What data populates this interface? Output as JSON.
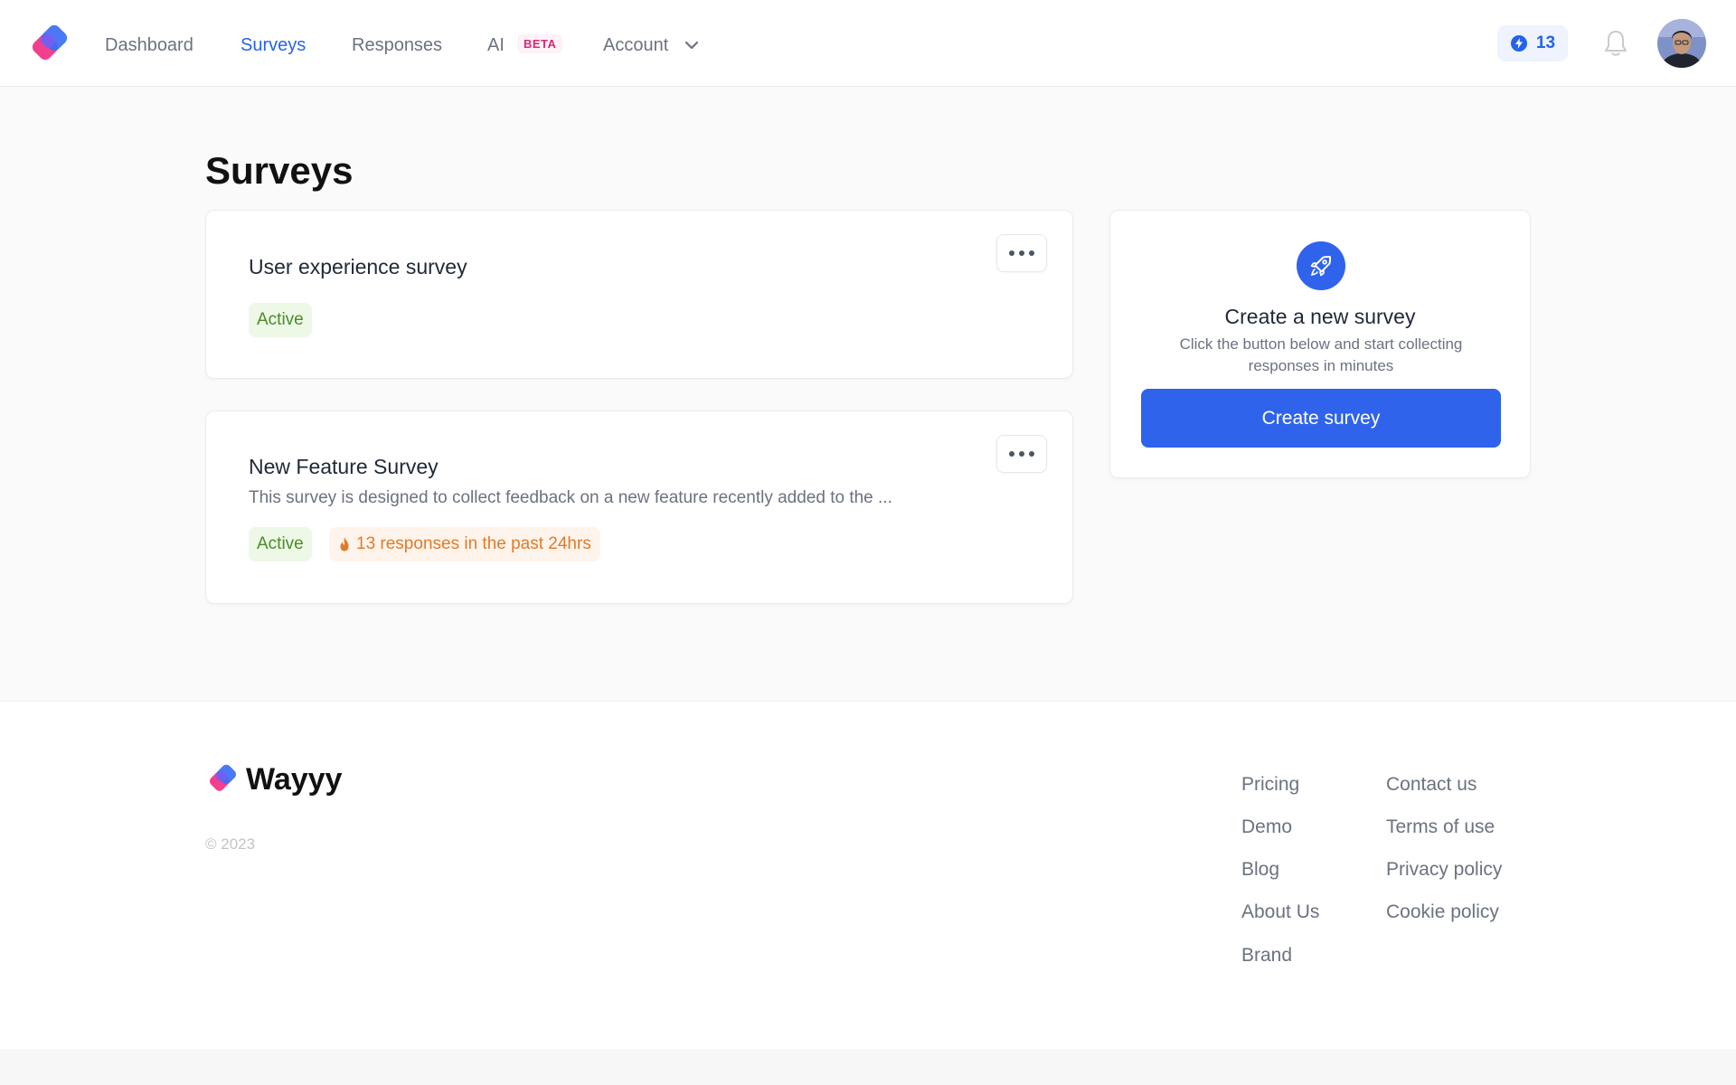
{
  "nav": {
    "links": [
      "Dashboard",
      "Surveys",
      "Responses",
      "AI",
      "Account"
    ],
    "active": "Surveys",
    "beta_label": "BETA",
    "credits": "13",
    "icons": {
      "logo": "wayyy-logo-icon",
      "credits": "bolt-circle-icon",
      "bell": "bell-icon",
      "account_dropdown": "chevron-down-icon"
    }
  },
  "main": {
    "title": "Surveys",
    "surveys": [
      {
        "title": "User experience survey",
        "description": "",
        "status": "Active",
        "activity": ""
      },
      {
        "title": "New Feature Survey",
        "description": "This survey is designed to collect feedback on a new feature recently added to the ...",
        "status": "Active",
        "activity": "13 responses in the past 24hrs"
      }
    ],
    "create_card": {
      "title": "Create a new survey",
      "subtitle": "Click the button below and start collecting responses in minutes",
      "button": "Create survey",
      "icon": "rocket-icon"
    }
  },
  "footer": {
    "brand": "Wayyy",
    "copyright": "© 2023",
    "col1": [
      "Pricing",
      "Demo",
      "Blog",
      "About Us",
      "Brand"
    ],
    "col2": [
      "Contact us",
      "Terms of use",
      "Privacy policy",
      "Cookie policy"
    ]
  },
  "colors": {
    "accent": "#2f63ec",
    "active_badge_bg": "#edf8e6",
    "active_badge_text": "#4d8a2b",
    "hot_badge_bg": "#fef4ec",
    "hot_badge_text": "#e07b2a",
    "beta": "#db2777"
  }
}
